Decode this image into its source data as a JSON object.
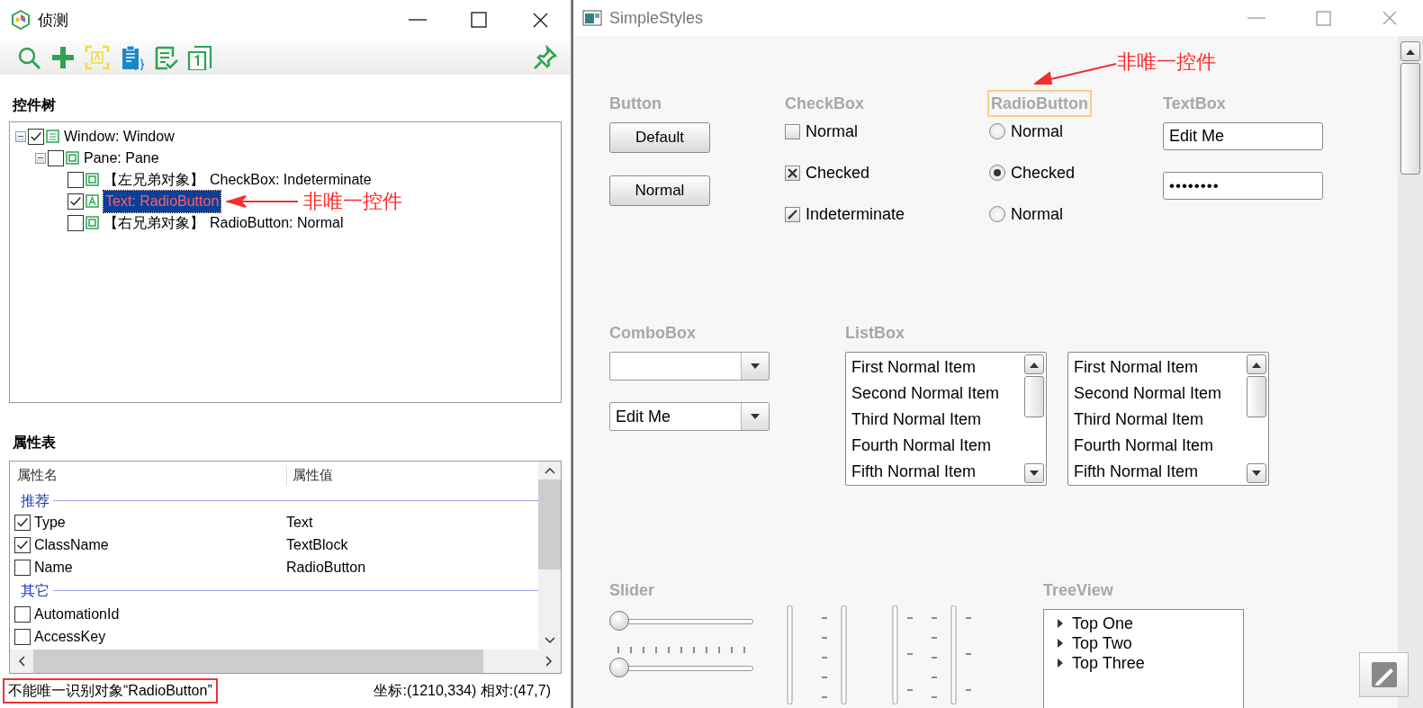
{
  "inspector": {
    "title": "侦测",
    "tree_heading": "控件树",
    "tree": [
      {
        "label": "Window: Window",
        "kind": "window",
        "checked": true,
        "expanded": true,
        "selected": false,
        "children": [
          {
            "label": "Pane: Pane",
            "kind": "pane",
            "checked": false,
            "expanded": true,
            "selected": false,
            "children": [
              {
                "relation": "【左兄弟对象】",
                "label": "CheckBox: Indeterminate",
                "kind": "pane",
                "checked": false,
                "selected": false
              },
              {
                "label": "Text: RadioButton",
                "kind": "text",
                "checked": true,
                "selected": true
              },
              {
                "relation": "【右兄弟对象】",
                "label": "RadioButton: Normal",
                "kind": "pane",
                "checked": false,
                "selected": false
              }
            ]
          }
        ]
      }
    ],
    "tree_annotation": "非唯一控件",
    "props_heading": "属性表",
    "props_columns": [
      "属性名",
      "属性值"
    ],
    "prop_groups": [
      {
        "name": "推荐",
        "rows": [
          {
            "name": "Type",
            "value": "Text",
            "checked": true
          },
          {
            "name": "ClassName",
            "value": "TextBlock",
            "checked": true
          },
          {
            "name": "Name",
            "value": "RadioButton",
            "checked": false
          }
        ]
      },
      {
        "name": "其它",
        "rows": [
          {
            "name": "AutomationId",
            "checked": false
          },
          {
            "name": "AccessKey",
            "checked": false
          }
        ]
      }
    ],
    "status": "不能唯一识别对象“RadioButton”",
    "coords": "坐标:(1210,334) 相对:(47,7)"
  },
  "app": {
    "title": "SimpleStyles",
    "annotation": "非唯一控件",
    "button": {
      "heading": "Button",
      "buttons": [
        "Default",
        "Normal"
      ]
    },
    "checkbox": {
      "heading": "CheckBox",
      "items": [
        {
          "label": "Normal",
          "checked": false,
          "indeterminate": false
        },
        {
          "label": "Checked",
          "checked": true,
          "indeterminate": false
        },
        {
          "label": "Indeterminate",
          "checked": false,
          "indeterminate": true
        }
      ]
    },
    "radio": {
      "heading": "RadioButton",
      "highlighted": true,
      "items": [
        {
          "label": "Normal",
          "selected": false
        },
        {
          "label": "Checked",
          "selected": true
        },
        {
          "label": "Normal",
          "selected": false
        }
      ]
    },
    "textbox": {
      "heading": "TextBox",
      "fields": [
        {
          "kind": "text",
          "value": "Edit Me"
        },
        {
          "kind": "password",
          "value": "••••••••"
        }
      ]
    },
    "combobox": {
      "heading": "ComboBox",
      "combos": [
        {
          "kind": "plain"
        },
        {
          "kind": "editable",
          "value": "Edit Me"
        }
      ]
    },
    "listbox": {
      "heading": "ListBox",
      "lists": [
        {
          "items": [
            "First Normal Item",
            "Second Normal Item",
            "Third Normal Item",
            "Fourth Normal Item",
            "Fifth Normal Item"
          ]
        },
        {
          "items": [
            "First Normal Item",
            "Second Normal Item",
            "Third Normal Item",
            "Fourth Normal Item",
            "Fifth Normal Item"
          ]
        }
      ]
    },
    "slider": {
      "heading": "Slider",
      "sliders": [
        {
          "ticks": false,
          "level": 0
        },
        {
          "ticks": true,
          "level": 0
        }
      ]
    },
    "treeview": {
      "heading": "TreeView",
      "items": [
        {
          "label": "Top One",
          "expanded": false
        },
        {
          "label": "Top Two",
          "expanded": false
        },
        {
          "label": "Top Three",
          "expanded": false
        }
      ]
    }
  }
}
